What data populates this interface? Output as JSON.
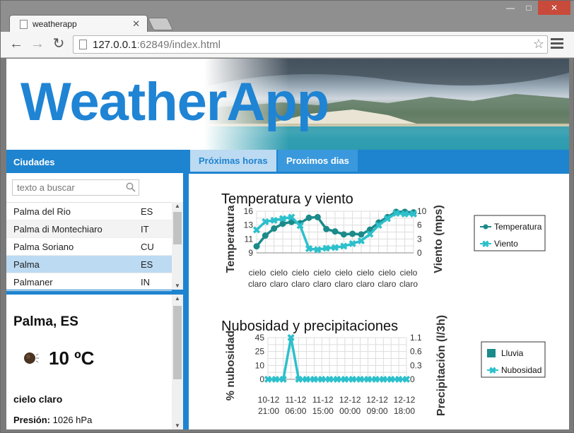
{
  "browser": {
    "tab_title": "weatherapp",
    "url_host": "127.0.0.1",
    "url_rest": ":62849/index.html"
  },
  "app": {
    "logo": "WeatherApp"
  },
  "cities": {
    "header": "Ciudades",
    "search_placeholder": "texto a buscar",
    "list": [
      {
        "name": "Palma del Rio",
        "country": "ES"
      },
      {
        "name": "Palma di Montechiaro",
        "country": "IT"
      },
      {
        "name": "Palma Soriano",
        "country": "CU"
      },
      {
        "name": "Palma",
        "country": "ES",
        "selected": true
      },
      {
        "name": "Palmaner",
        "country": "IN"
      }
    ]
  },
  "detail": {
    "city": "Palma, ES",
    "temperature": "10 ºC",
    "description": "cielo claro",
    "pressure_label": "Presión:",
    "pressure_value": "1026 hPa"
  },
  "tabs": [
    {
      "label": "Próximas horas",
      "active": true
    },
    {
      "label": "Proximos dias",
      "active": false
    }
  ],
  "chart_data": [
    {
      "type": "line",
      "title": "Temperatura y viento",
      "ylabel": "Temperatura",
      "y2label": "Viento (mps)",
      "ylim": [
        9,
        16
      ],
      "yticks": [
        "16",
        "13",
        "11",
        "9"
      ],
      "y2lim": [
        0,
        10
      ],
      "y2ticks": [
        "10",
        "6",
        "3",
        "0"
      ],
      "categories": [
        "cielo claro",
        "cielo claro",
        "cielo claro",
        "cielo claro",
        "cielo claro",
        "cielo claro",
        "cielo claro",
        "cielo claro"
      ],
      "series": [
        {
          "name": "Temperatura",
          "color": "#1b8a8a",
          "axis": "left",
          "values": [
            10.1,
            11.9,
            13.1,
            13.9,
            14.2,
            14.0,
            14.9,
            15.0,
            13.0,
            12.6,
            12.1,
            12.2,
            12.1,
            12.9,
            14.1,
            15.0,
            15.9,
            15.9,
            15.8
          ]
        },
        {
          "name": "Viento",
          "color": "#2cc0cc",
          "axis": "right",
          "values": [
            5.5,
            7.5,
            7.8,
            8.2,
            8.6,
            6.5,
            1.0,
            0.8,
            1.1,
            1.3,
            1.6,
            2.2,
            2.9,
            4.5,
            6.6,
            8.2,
            9.5,
            9.3,
            9.3
          ]
        }
      ],
      "legend": "right"
    },
    {
      "type": "line",
      "title": "Nubosidad y precipitaciones",
      "ylabel": "% nubosidad",
      "y2label": "Precipitación (l/3h)",
      "ylim": [
        0,
        45
      ],
      "yticks": [
        "45",
        "25",
        "10",
        "0"
      ],
      "y2lim": [
        0,
        1.1
      ],
      "y2ticks": [
        "1.1",
        "0.6",
        "0.3",
        "0"
      ],
      "categories": [
        "10-12 21:00",
        "11-12 06:00",
        "11-12 15:00",
        "12-12 00:00",
        "12-12 09:00",
        "12-12 18:00"
      ],
      "series": [
        {
          "name": "Nubosidad",
          "color": "#2cc0cc",
          "axis": "left",
          "values": [
            0,
            0,
            0,
            45,
            0,
            0,
            0,
            0,
            0,
            0,
            0,
            0,
            0,
            0,
            0,
            0,
            0,
            0,
            0
          ]
        },
        {
          "name": "Lluvia",
          "color": "#1b8a8a",
          "axis": "right",
          "values": []
        }
      ],
      "legend": "right"
    }
  ]
}
